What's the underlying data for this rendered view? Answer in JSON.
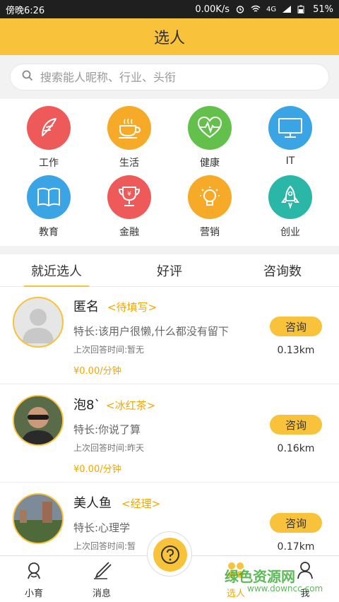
{
  "status": {
    "time": "傍晚6:26",
    "speed": "0.00K/s",
    "network": "4G",
    "battery": "51%"
  },
  "header": {
    "title": "选人"
  },
  "search": {
    "placeholder": "搜索能人昵称、行业、头衔"
  },
  "categories": [
    {
      "label": "工作",
      "icon": "feather-icon",
      "color": "#ee5a5a"
    },
    {
      "label": "生活",
      "icon": "coffee-cup-icon",
      "color": "#f7a928"
    },
    {
      "label": "健康",
      "icon": "heart-pulse-icon",
      "color": "#62c04b"
    },
    {
      "label": "IT",
      "icon": "monitor-icon",
      "color": "#3aa4e4"
    },
    {
      "label": "教育",
      "icon": "book-icon",
      "color": "#3aa4e4"
    },
    {
      "label": "金融",
      "icon": "trophy-icon",
      "color": "#ee5a5a"
    },
    {
      "label": "营销",
      "icon": "lightbulb-icon",
      "color": "#f7a928"
    },
    {
      "label": "创业",
      "icon": "rocket-icon",
      "color": "#2bb7a8"
    }
  ],
  "tabs": [
    {
      "label": "就近选人",
      "active": true
    },
    {
      "label": "好评",
      "active": false
    },
    {
      "label": "咨询数",
      "active": false
    }
  ],
  "experts": [
    {
      "name": "匿名",
      "tag": "<待填写>",
      "spec": "特长:该用户很懒,什么都没有留下",
      "last": "上次回答时间:暂无",
      "price": "¥0.00/分钟",
      "distance": "0.13km",
      "consult": "咨询"
    },
    {
      "name": "泡8`",
      "tag": "<冰红茶>",
      "spec": "特长:你说了算",
      "last": "上次回答时间:昨天",
      "price": "¥0.00/分钟",
      "distance": "0.16km",
      "consult": "咨询"
    },
    {
      "name": "美人鱼",
      "tag": "<经理>",
      "spec": "特长:心理学",
      "last": "上次回答时间:暂",
      "price": "",
      "distance": "0.17km",
      "consult": "咨询"
    }
  ],
  "nav": [
    {
      "label": "小育",
      "icon": "person-icon"
    },
    {
      "label": "消息",
      "icon": "pen-icon"
    },
    {
      "label": "选人",
      "icon": "grid-icon"
    },
    {
      "label": "我",
      "icon": "user-icon"
    }
  ],
  "center_button": {
    "icon": "question-icon"
  },
  "watermark": {
    "main": "绿色资源网",
    "sub": "www.downcc.com"
  },
  "colors": {
    "accent": "#f8c23a",
    "tag": "#f0a800",
    "statusbar": "#1f1f1f"
  }
}
